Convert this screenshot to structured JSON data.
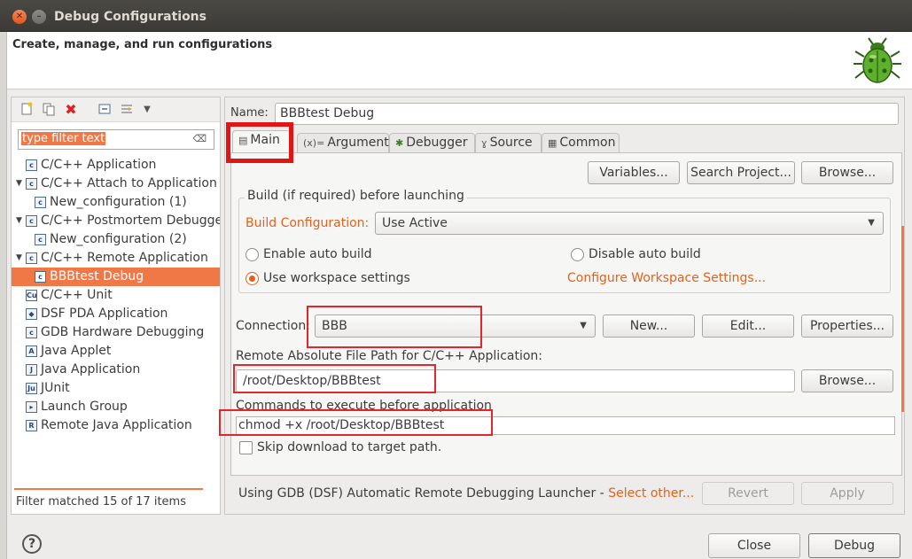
{
  "window": {
    "title": "Debug Configurations",
    "subtitle": "Create, manage, and run configurations"
  },
  "left": {
    "filter_placeholder": "type filter text",
    "toolbar": [
      "new-config-icon",
      "duplicate-icon",
      "delete-icon",
      "collapse-all-icon",
      "filter-icon",
      "dropdown-icon"
    ],
    "tree": [
      {
        "label": "C/C++ Application",
        "level": 0,
        "expanded": null,
        "icon": "c-app-icon"
      },
      {
        "label": "C/C++ Attach to Application",
        "level": 0,
        "expanded": true,
        "icon": "c-app-icon"
      },
      {
        "label": "New_configuration (1)",
        "level": 1,
        "expanded": null,
        "icon": "c-app-icon"
      },
      {
        "label": "C/C++ Postmortem Debugger",
        "level": 0,
        "expanded": true,
        "icon": "c-app-icon"
      },
      {
        "label": "New_configuration (2)",
        "level": 1,
        "expanded": null,
        "icon": "c-app-icon"
      },
      {
        "label": "C/C++ Remote Application",
        "level": 0,
        "expanded": true,
        "icon": "c-app-icon"
      },
      {
        "label": "BBBtest Debug",
        "level": 1,
        "expanded": null,
        "icon": "c-app-icon",
        "selected": true
      },
      {
        "label": "C/C++ Unit",
        "level": 0,
        "expanded": null,
        "icon": "cu-icon"
      },
      {
        "label": "DSF PDA Application",
        "level": 0,
        "expanded": null,
        "icon": "pda-icon"
      },
      {
        "label": "GDB Hardware Debugging",
        "level": 0,
        "expanded": null,
        "icon": "c-app-icon"
      },
      {
        "label": "Java Applet",
        "level": 0,
        "expanded": null,
        "icon": "java-applet-icon"
      },
      {
        "label": "Java Application",
        "level": 0,
        "expanded": null,
        "icon": "java-app-icon"
      },
      {
        "label": "JUnit",
        "level": 0,
        "expanded": null,
        "icon": "junit-icon"
      },
      {
        "label": "Launch Group",
        "level": 0,
        "expanded": null,
        "icon": "launch-group-icon"
      },
      {
        "label": "Remote Java Application",
        "level": 0,
        "expanded": null,
        "icon": "remote-java-icon"
      }
    ],
    "status": "Filter matched 15 of 17 items"
  },
  "right": {
    "name_label": "Name:",
    "name_value": "BBBtest Debug",
    "tabs": [
      {
        "label": "Main",
        "icon": "main-icon",
        "active": true
      },
      {
        "label": "Arguments",
        "icon": "arguments-icon"
      },
      {
        "label": "Debugger",
        "icon": "debugger-icon"
      },
      {
        "label": "Source",
        "icon": "source-icon"
      },
      {
        "label": "Common",
        "icon": "common-icon"
      }
    ],
    "main": {
      "variables_btn": "Variables...",
      "search_project_btn": "Search Project...",
      "browse_btn": "Browse...",
      "build_group_title": "Build (if required) before launching",
      "build_config_label": "Build Configuration:",
      "build_config_value": "Use Active",
      "enable_auto_build": "Enable auto build",
      "disable_auto_build": "Disable auto build",
      "use_workspace_settings": "Use workspace settings",
      "configure_workspace_link": "Configure Workspace Settings...",
      "connection_label": "Connection:",
      "connection_value": "BBB",
      "new_btn": "New...",
      "edit_btn": "Edit...",
      "properties_btn": "Properties...",
      "remote_path_label": "Remote Absolute File Path for C/C++ Application:",
      "remote_path_value": "/root/Desktop/BBBtest",
      "browse2_btn": "Browse...",
      "commands_label": "Commands to execute before application",
      "commands_value": "chmod +x /root/Desktop/BBBtest",
      "skip_download_label": "Skip download to target path."
    },
    "launcher_text": "Using GDB (DSF) Automatic Remote Debugging Launcher - ",
    "select_other_link": "Select other...",
    "revert_btn": "Revert",
    "apply_btn": "Apply"
  },
  "footer": {
    "close_btn": "Close",
    "debug_btn": "Debug",
    "help_icon": "?"
  },
  "colors": {
    "accent": "#f07746",
    "link": "#e2621d",
    "highlight_box": "#e3262a"
  }
}
